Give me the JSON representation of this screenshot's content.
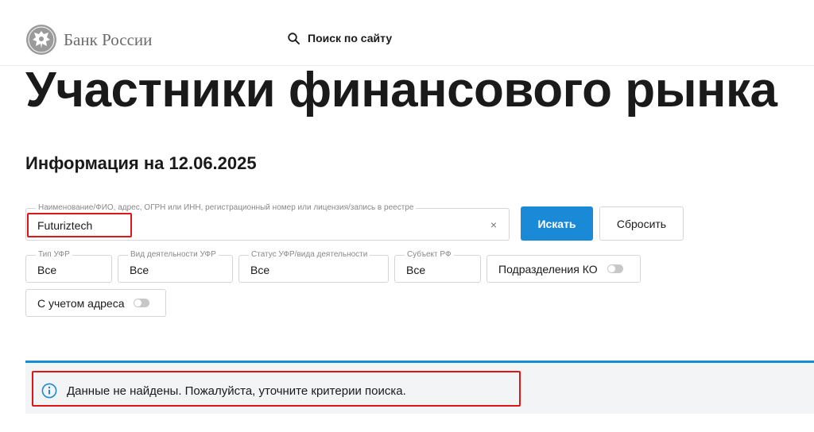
{
  "header": {
    "logo_text": "Банк России",
    "logo_icon": "eagle-emblem-icon",
    "search_label": "Поиск по сайту",
    "search_icon": "search-icon"
  },
  "page": {
    "title": "Участники финансового рынка",
    "info_date": "Информация на 12.06.2025"
  },
  "search": {
    "main_label": "Наименование/ФИО, адрес, ОГРН или ИНН, регистрационный номер или лицензия/запись в реестре",
    "main_value": "Futuriztech",
    "clear_glyph": "×",
    "submit_label": "Искать",
    "reset_label": "Сбросить"
  },
  "filters": {
    "type": {
      "label": "Тип УФР",
      "value": "Все"
    },
    "activity": {
      "label": "Вид деятельности УФР",
      "value": "Все"
    },
    "status": {
      "label": "Статус УФР/вида деятельности",
      "value": "Все"
    },
    "subject": {
      "label": "Субъект РФ",
      "value": "Все"
    },
    "ko_divisions": {
      "label": "Подразделения КО",
      "on": false
    },
    "with_address": {
      "label": "С учетом адреса",
      "on": false
    }
  },
  "result": {
    "icon": "info-icon",
    "message": "Данные не найдены. Пожалуйста, уточните критерии поиска."
  },
  "colors": {
    "accent": "#1a8ad6",
    "highlight": "#e01616",
    "band": "#f3f4f6"
  }
}
